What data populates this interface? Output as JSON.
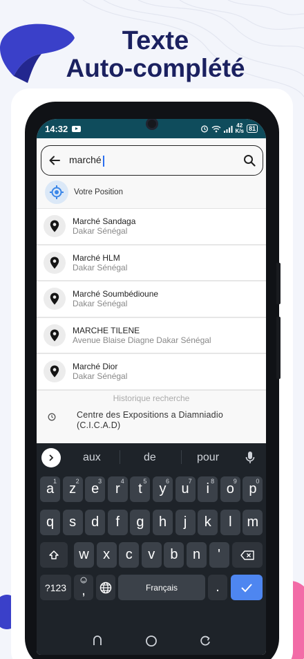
{
  "promo": {
    "line1": "Texte",
    "line2": "Auto-complété"
  },
  "status": {
    "time": "14:32",
    "speed_top": "42",
    "speed_bottom": "K/s",
    "battery": "81"
  },
  "search": {
    "value": "marché"
  },
  "current_position": {
    "label": "Votre Position"
  },
  "results": [
    {
      "name": "Marché Sandaga",
      "address": "Dakar Sénégal"
    },
    {
      "name": "Marché HLM",
      "address": "Dakar Sénégal"
    },
    {
      "name": "Marché Soumbédioune",
      "address": "Dakar Sénégal"
    },
    {
      "name": "MARCHE TILENE",
      "address": "Avenue Blaise Diagne Dakar Sénégal"
    },
    {
      "name": "Marché Dior",
      "address": "Dakar Sénégal"
    }
  ],
  "history": {
    "title": "Historique recherche",
    "items": [
      {
        "line1": "Centre des Expositions a Diamniadio",
        "line2": "(C.I.C.A.D)"
      }
    ]
  },
  "keyboard": {
    "suggestions": [
      "aux",
      "de",
      "pour"
    ],
    "row1": [
      {
        "k": "a",
        "n": "1"
      },
      {
        "k": "z",
        "n": "2"
      },
      {
        "k": "e",
        "n": "3"
      },
      {
        "k": "r",
        "n": "4"
      },
      {
        "k": "t",
        "n": "5"
      },
      {
        "k": "y",
        "n": "6"
      },
      {
        "k": "u",
        "n": "7"
      },
      {
        "k": "i",
        "n": "8"
      },
      {
        "k": "o",
        "n": "9"
      },
      {
        "k": "p",
        "n": "0"
      }
    ],
    "row2": [
      "q",
      "s",
      "d",
      "f",
      "g",
      "h",
      "j",
      "k",
      "l",
      "m"
    ],
    "row3": [
      "w",
      "x",
      "c",
      "v",
      "b",
      "n",
      "'"
    ],
    "symbols_label": "?123",
    "space_label": "Français",
    "period": ".",
    "comma": ","
  },
  "colors": {
    "status_bar": "#0f4c5c",
    "accent": "#4e86f0",
    "promo_text": "#1b2160"
  }
}
